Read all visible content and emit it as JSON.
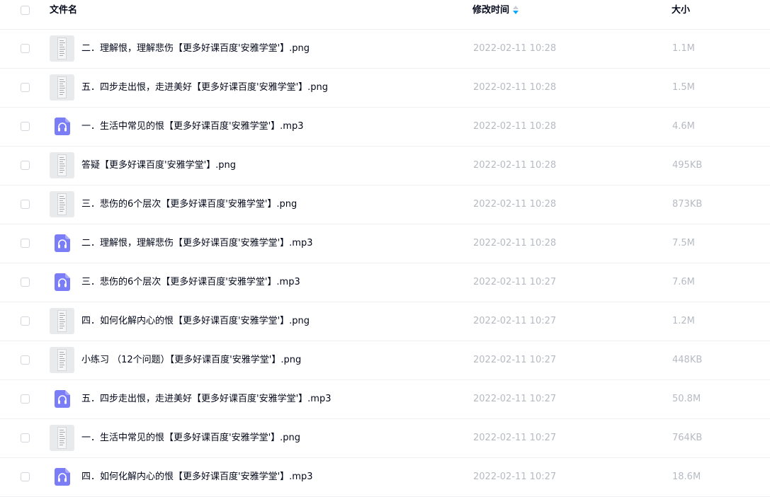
{
  "header": {
    "name_label": "文件名",
    "time_label": "修改时间",
    "size_label": "大小"
  },
  "colors": {
    "audio_icon": "#7b7df6",
    "sort_icon": "#06a7ff",
    "muted_text": "#b6bac2"
  },
  "files": [
    {
      "name": "二．理解恨，理解悲伤【更多好课百度'安雅学堂'】.png",
      "time": "2022-02-11 10:28",
      "size": "1.1M",
      "icon": "image-file-icon"
    },
    {
      "name": "五．四步走出恨，走进美好【更多好课百度'安雅学堂'】.png",
      "time": "2022-02-11 10:28",
      "size": "1.5M",
      "icon": "image-file-icon"
    },
    {
      "name": "一．生活中常见的恨【更多好课百度'安雅学堂'】.mp3",
      "time": "2022-02-11 10:28",
      "size": "4.6M",
      "icon": "audio-file-icon"
    },
    {
      "name": "答疑【更多好课百度'安雅学堂'】.png",
      "time": "2022-02-11 10:28",
      "size": "495KB",
      "icon": "image-file-icon"
    },
    {
      "name": "三．悲伤的6个层次【更多好课百度'安雅学堂'】.png",
      "time": "2022-02-11 10:28",
      "size": "873KB",
      "icon": "image-file-icon"
    },
    {
      "name": "二．理解恨，理解悲伤【更多好课百度'安雅学堂'】.mp3",
      "time": "2022-02-11 10:28",
      "size": "7.5M",
      "icon": "audio-file-icon"
    },
    {
      "name": "三．悲伤的6个层次【更多好课百度'安雅学堂'】.mp3",
      "time": "2022-02-11 10:27",
      "size": "7.6M",
      "icon": "audio-file-icon"
    },
    {
      "name": "四．如何化解内心的恨【更多好课百度'安雅学堂'】.png",
      "time": "2022-02-11 10:27",
      "size": "1.2M",
      "icon": "image-file-icon"
    },
    {
      "name": "小练习 （12个问题）【更多好课百度'安雅学堂'】.png",
      "time": "2022-02-11 10:27",
      "size": "448KB",
      "icon": "image-file-icon"
    },
    {
      "name": "五．四步走出恨，走进美好【更多好课百度'安雅学堂'】.mp3",
      "time": "2022-02-11 10:27",
      "size": "50.8M",
      "icon": "audio-file-icon"
    },
    {
      "name": "一．生活中常见的恨【更多好课百度'安雅学堂'】.png",
      "time": "2022-02-11 10:27",
      "size": "764KB",
      "icon": "image-file-icon"
    },
    {
      "name": "四．如何化解内心的恨【更多好课百度'安雅学堂'】.mp3",
      "time": "2022-02-11 10:27",
      "size": "18.6M",
      "icon": "audio-file-icon"
    }
  ]
}
